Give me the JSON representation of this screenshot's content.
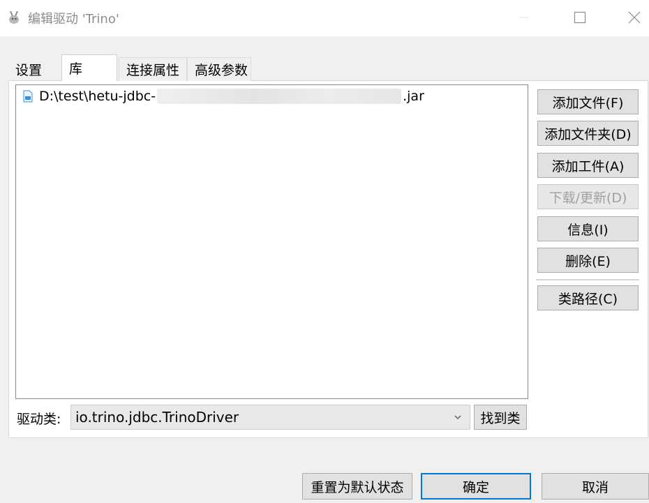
{
  "window": {
    "title": "编辑驱动 'Trino'"
  },
  "tabs": [
    {
      "label": "设置",
      "active": false
    },
    {
      "label": "库",
      "active": true
    },
    {
      "label": "连接属性",
      "active": false
    },
    {
      "label": "高级参数",
      "active": false
    }
  ],
  "library": {
    "files": [
      {
        "prefix": "D:\\test\\hetu-jdbc-",
        "suffix": ".jar",
        "icon": "jar-file-icon"
      }
    ]
  },
  "side_buttons": {
    "add_file": "添加文件(F)",
    "add_folder": "添加文件夹(D)",
    "add_artifact": "添加工件(A)",
    "download_update": "下载/更新(D)",
    "info": "信息(I)",
    "delete": "删除(E)",
    "classpath": "类路径(C)"
  },
  "driver": {
    "label": "驱动类:",
    "value": "io.trino.jdbc.TrinoDriver",
    "find_class": "找到类"
  },
  "footer": {
    "reset": "重置为默认状态",
    "ok": "确定",
    "cancel": "取消"
  },
  "colors": {
    "ok_border": "#0078d7",
    "title_text": "#8c8c8c"
  }
}
